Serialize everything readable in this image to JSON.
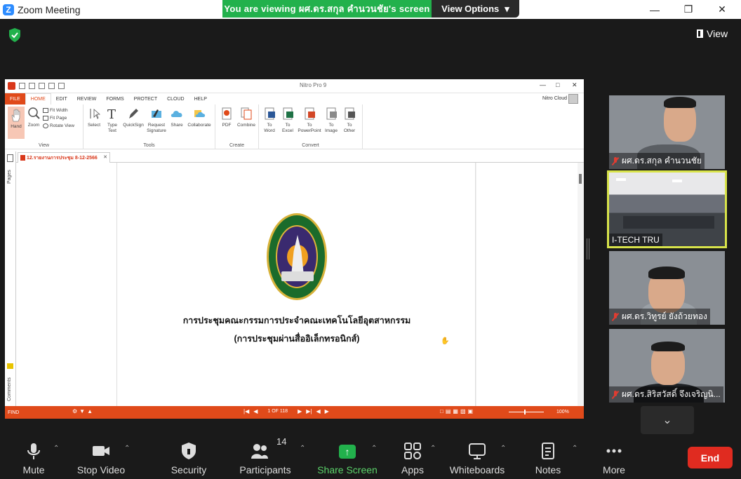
{
  "window": {
    "title": "Zoom Meeting",
    "logo_letter": "Z",
    "viewing_banner": "You are viewing ผศ.ดร.สกุล คำนวนชัย's screen",
    "view_options": "View Options",
    "view_button": "View"
  },
  "shared_screen": {
    "app_title": "Nitro Pro 9",
    "ribbon_tabs": [
      "FILE",
      "HOME",
      "EDIT",
      "REVIEW",
      "FORMS",
      "PROTECT",
      "CLOUD",
      "HELP"
    ],
    "account": "Nitro Cloud",
    "groups": {
      "view": {
        "title": "View",
        "hand": "Hand",
        "zoom": "Zoom",
        "fit_width": "Fit Width",
        "fit_page": "Fit Page",
        "rotate_view": "Rotate View"
      },
      "tools": {
        "title": "Tools",
        "select": "Select",
        "type_text_1": "Type",
        "type_text_2": "Text",
        "quicksign": "QuickSign",
        "request_1": "Request",
        "request_2": "Signature",
        "share": "Share",
        "collaborate": "Collaborate"
      },
      "create": {
        "title": "Create",
        "pdf": "PDF",
        "combine": "Combine"
      },
      "convert": {
        "title": "Convert",
        "to": "To",
        "word": "Word",
        "excel": "Excel",
        "powerpoint": "PowerPoint",
        "image": "Image",
        "other": "Other"
      }
    },
    "document_tab": "12.รายงานการประชุม 8-12-2566",
    "side_labels": {
      "pages": "Pages",
      "comments": "Comments"
    },
    "document": {
      "line1": "การประชุมคณะกรรมการประจำคณะเทคโนโลยีอุตสาหกรรม",
      "line2": "(การประชุมผ่านสื่ออิเล็กทรอนิกส์)"
    },
    "statusbar": {
      "find": "FIND",
      "page_count": "1 OF 118",
      "zoom": "100%"
    }
  },
  "participants_gallery": [
    {
      "name": "ผศ.ดร.สกุล คำนวนชัย",
      "muted": true,
      "active": false
    },
    {
      "name": "I-TECH TRU",
      "muted": false,
      "active": true
    },
    {
      "name": "ผศ.ดร.วิทูรย์ ยังถ้วยทอง",
      "muted": true,
      "active": false
    },
    {
      "name": "ผศ.ดร.สิริสวัสดิ์ จึงเจริญนิ...",
      "muted": true,
      "active": false
    }
  ],
  "toolbar": {
    "mute": "Mute",
    "stop_video": "Stop Video",
    "security": "Security",
    "participants": "Participants",
    "participants_count": "14",
    "share_screen": "Share Screen",
    "apps": "Apps",
    "whiteboards": "Whiteboards",
    "notes": "Notes",
    "more": "More",
    "end": "End"
  },
  "colors": {
    "banner_green": "#22b14c",
    "end_red": "#e02b20",
    "nitro_orange": "#e04a1a",
    "active_speaker": "#d8e34a"
  }
}
